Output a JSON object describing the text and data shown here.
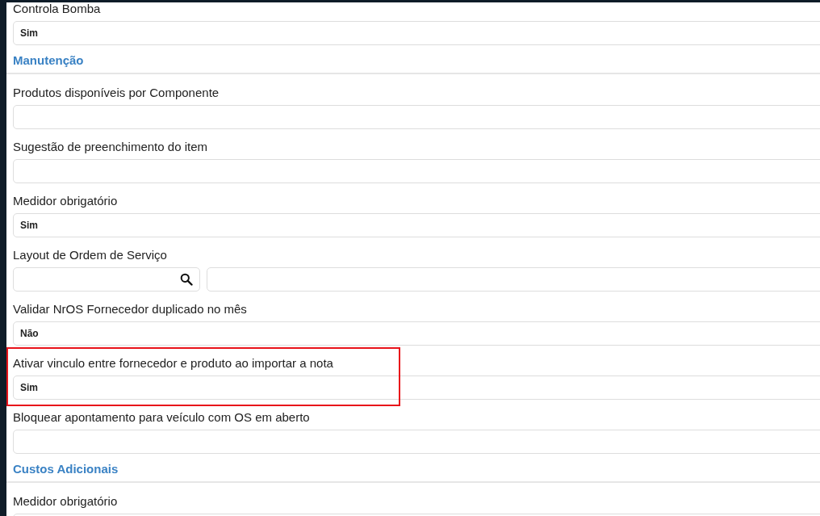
{
  "items": [
    {
      "kind": "field",
      "label": "Controla Bomba",
      "value": "Sim",
      "highlighted": false
    },
    {
      "kind": "section",
      "title": "Manutenção"
    },
    {
      "kind": "field",
      "label": "Produtos disponíveis por Componente",
      "value": "",
      "highlighted": false
    },
    {
      "kind": "field",
      "label": "Sugestão de preenchimento do item",
      "value": "",
      "highlighted": false
    },
    {
      "kind": "field",
      "label": "Medidor obrigatório",
      "value": "Sim",
      "highlighted": false
    },
    {
      "kind": "lookup",
      "label": "Layout de Ordem de Serviço",
      "highlighted": false
    },
    {
      "kind": "field",
      "label": "Validar NrOS Fornecedor duplicado no mês",
      "value": "Não",
      "highlighted": false
    },
    {
      "kind": "field",
      "label": "Ativar vinculo entre fornecedor e produto ao importar a nota",
      "value": "Sim",
      "highlighted": true
    },
    {
      "kind": "field",
      "label": "Bloquear apontamento para veículo com OS em aberto",
      "value": "",
      "highlighted": false
    },
    {
      "kind": "section",
      "title": "Custos Adicionais"
    },
    {
      "kind": "field",
      "label": "Medidor obrigatório",
      "value": "",
      "highlighted": false
    }
  ]
}
